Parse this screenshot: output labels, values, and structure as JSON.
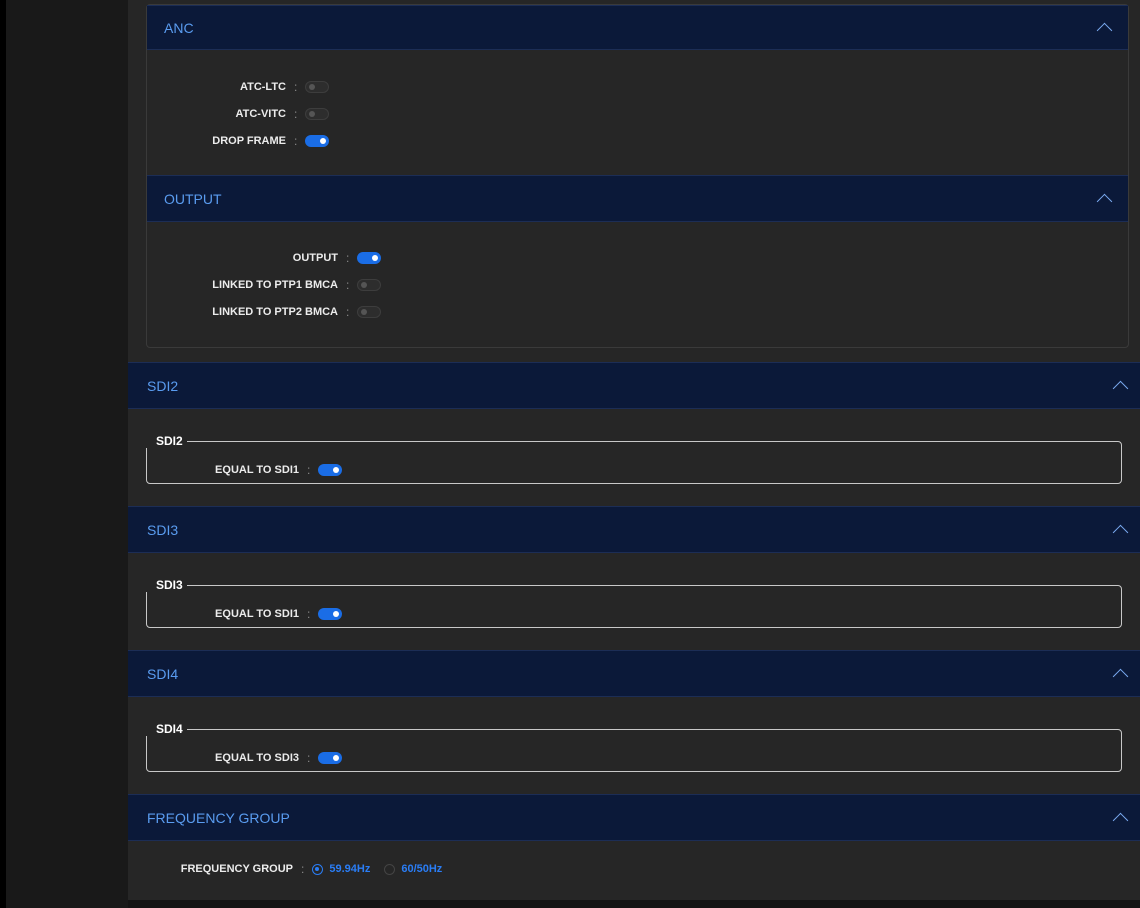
{
  "anc": {
    "title": "ANC",
    "rows": [
      {
        "label": "ATC-LTC",
        "state": "off"
      },
      {
        "label": "ATC-VITC",
        "state": "off"
      },
      {
        "label": "DROP FRAME",
        "state": "on"
      }
    ]
  },
  "output": {
    "title": "OUTPUT",
    "rows": [
      {
        "label": "OUTPUT",
        "state": "on"
      },
      {
        "label": "LINKED TO PTP1 BMCA",
        "state": "off"
      },
      {
        "label": "LINKED TO PTP2 BMCA",
        "state": "off"
      }
    ]
  },
  "sdi2": {
    "title": "SDI2",
    "legend": "SDI2",
    "row_label": "EQUAL TO SDI1",
    "state": "on"
  },
  "sdi3": {
    "title": "SDI3",
    "legend": "SDI3",
    "row_label": "EQUAL TO SDI1",
    "state": "on"
  },
  "sdi4": {
    "title": "SDI4",
    "legend": "SDI4",
    "row_label": "EQUAL TO SDI3",
    "state": "on"
  },
  "frequency_group": {
    "title": "FREQUENCY GROUP",
    "label": "FREQUENCY GROUP",
    "options": [
      "59.94Hz",
      "60/50Hz"
    ],
    "selected": "59.94Hz"
  },
  "separator": ":",
  "colors": {
    "accent": "#1a6de6",
    "header_bg": "#0b1939",
    "header_text": "#5a9cf0"
  }
}
